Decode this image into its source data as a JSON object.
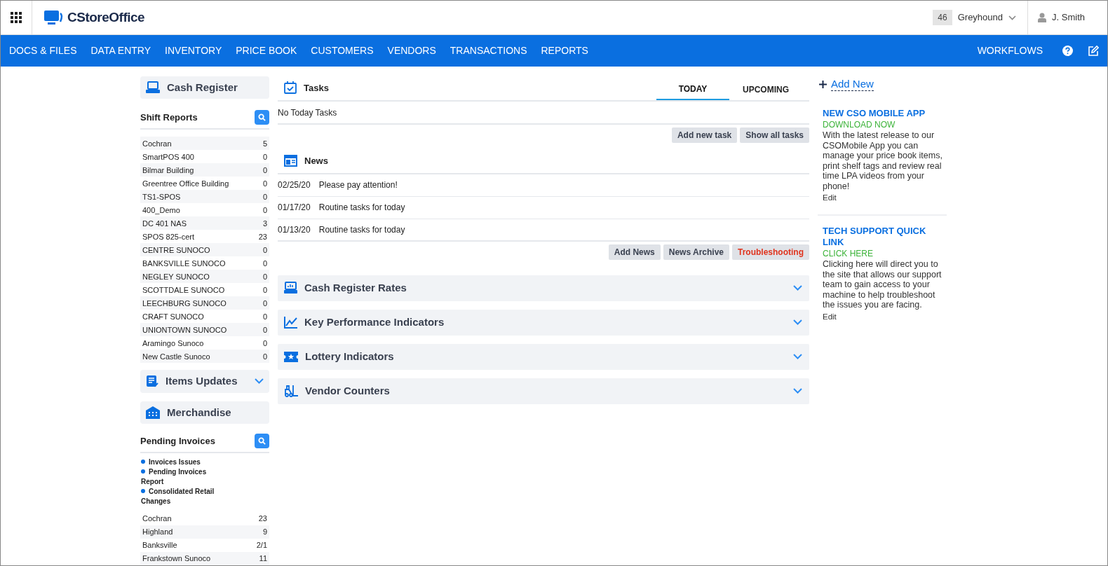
{
  "header": {
    "app_title": "CStoreOffice",
    "store_count": "46",
    "store_name": "Greyhound",
    "user": "J. Smith"
  },
  "nav": {
    "items": [
      "DOCS & FILES",
      "DATA ENTRY",
      "INVENTORY",
      "PRICE BOOK",
      "CUSTOMERS",
      "VENDORS",
      "TRANSACTIONS",
      "REPORTS"
    ],
    "right_item": "WORKFLOWS"
  },
  "cash_register": {
    "title": "Cash Register"
  },
  "shift_reports": {
    "title": "Shift Reports",
    "rows": [
      {
        "name": "Cochran",
        "count": "5"
      },
      {
        "name": "SmartPOS 400",
        "count": "0"
      },
      {
        "name": "Bilmar Building",
        "count": "0"
      },
      {
        "name": "Greentree Office Building",
        "count": "0"
      },
      {
        "name": "TS1-SPOS",
        "count": "0"
      },
      {
        "name": "400_Demo",
        "count": "0"
      },
      {
        "name": "DC 401 NAS",
        "count": "3"
      },
      {
        "name": "SPOS 825-cert",
        "count": "23"
      },
      {
        "name": "CENTRE SUNOCO",
        "count": "0"
      },
      {
        "name": "BANKSVILLE SUNOCO",
        "count": "0"
      },
      {
        "name": "NEGLEY SUNOCO",
        "count": "0"
      },
      {
        "name": "SCOTTDALE SUNOCO",
        "count": "0"
      },
      {
        "name": "LEECHBURG SUNOCO",
        "count": "0"
      },
      {
        "name": "CRAFT SUNOCO",
        "count": "0"
      },
      {
        "name": "UNIONTOWN SUNOCO",
        "count": "0"
      },
      {
        "name": "Aramingo Sunoco",
        "count": "0"
      },
      {
        "name": "New Castle Sunoco",
        "count": "0"
      }
    ]
  },
  "items_updates": {
    "title": "Items Updates",
    "expanded": false
  },
  "merchandise": {
    "title": "Merchandise"
  },
  "pending_invoices": {
    "title": "Pending Invoices",
    "links": [
      "Invoices Issues",
      "Pending Invoices Report",
      "Consolidated Retail Changes"
    ],
    "rows": [
      {
        "name": "Cochran",
        "count": "23"
      },
      {
        "name": "Highland",
        "count": "9"
      },
      {
        "name": "Banksville",
        "count": "2/1"
      },
      {
        "name": "Frankstown Sunoco",
        "count": "11"
      }
    ]
  },
  "tasks": {
    "title": "Tasks",
    "tabs": [
      {
        "label": "TODAY",
        "selected": true
      },
      {
        "label": "UPCOMING",
        "selected": false
      }
    ],
    "empty_text": "No Today Tasks",
    "buttons": [
      "Add new task",
      "Show all tasks"
    ]
  },
  "news": {
    "title": "News",
    "items": [
      {
        "date": "02/25/20",
        "text": "Please pay attention!"
      },
      {
        "date": "01/17/20",
        "text": "Routine tasks for today"
      },
      {
        "date": "01/13/20",
        "text": "Routine tasks for today"
      }
    ],
    "buttons": [
      {
        "label": "Add News",
        "kind": "normal"
      },
      {
        "label": "News Archive",
        "kind": "normal"
      },
      {
        "label": "Troubleshooting",
        "kind": "danger"
      }
    ]
  },
  "accordions": [
    {
      "title": "Cash Register Rates",
      "expanded": false
    },
    {
      "title": "Key Performance Indicators",
      "expanded": false
    },
    {
      "title": "Lottery Indicators",
      "expanded": false
    },
    {
      "title": "Vendor Counters",
      "expanded": false
    }
  ],
  "add_new": "Add New",
  "cards": [
    {
      "title": "NEW CSO MOBILE APP",
      "link": "DOWNLOAD NOW",
      "body": "With the latest release to our CSOMobile App you can manage your price book items, print shelf tags and review real time LPA videos from your phone!",
      "edit": "Edit"
    },
    {
      "title": "TECH SUPPORT QUICK LINK",
      "link": "CLICK HERE",
      "body": "Clicking here will direct you to the site that allows our support team to gain access to your machine to help troubleshoot the issues you are facing.",
      "edit": "Edit"
    }
  ]
}
